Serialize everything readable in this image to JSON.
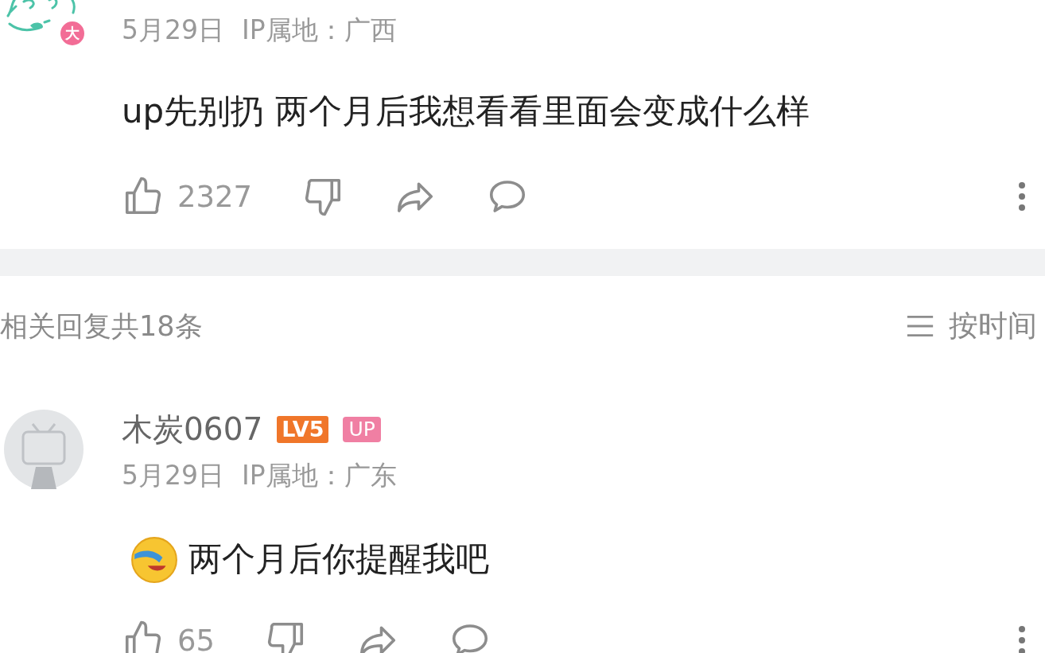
{
  "top_comment": {
    "avatar_badge": "大",
    "date": "5月29日",
    "ip": "IP属地：广西",
    "text": "up先别扔 两个月后我想看看里面会变成什么样",
    "likes": "2327"
  },
  "replies_header": {
    "count": "相关回复共18条",
    "sort": "按时间"
  },
  "reply": {
    "username": "木炭0607",
    "level": "LV5",
    "up_badge": "UP",
    "date": "5月29日",
    "ip": "IP属地：广东",
    "text": "两个月后你提醒我吧",
    "likes": "65"
  }
}
